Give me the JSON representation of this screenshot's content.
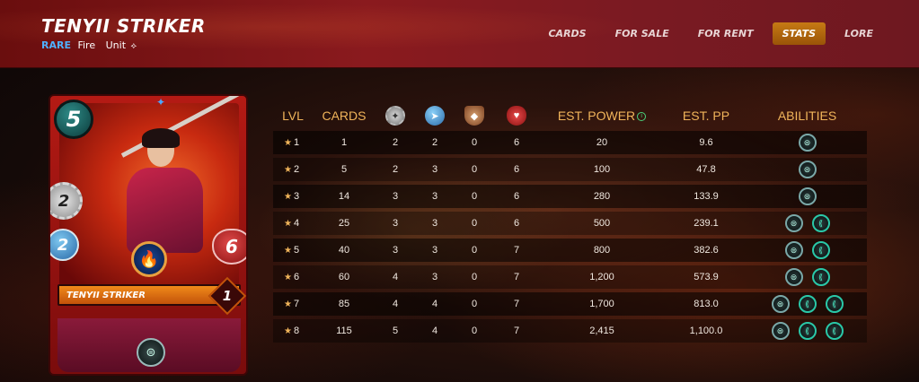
{
  "header": {
    "title": "TENYII STRIKER",
    "rarity": "RARE",
    "element": "Fire",
    "type": "Unit",
    "type_icon": "unit-icon"
  },
  "nav": {
    "tabs": [
      {
        "label": "CARDS",
        "active": false
      },
      {
        "label": "FOR SALE",
        "active": false
      },
      {
        "label": "FOR RENT",
        "active": false
      },
      {
        "label": "STATS",
        "active": true
      },
      {
        "label": "LORE",
        "active": false
      }
    ]
  },
  "card": {
    "mana": "5",
    "attack": "2",
    "speed": "2",
    "health": "6",
    "name": "TENYII STRIKER",
    "level": "1",
    "element_icon": "fire-element-icon",
    "ability_icon": "shield-ability-icon"
  },
  "table": {
    "headers": {
      "lvl": "LVL",
      "cards": "CARDS",
      "attack_icon": "melee-attack-icon",
      "speed_icon": "speed-icon",
      "armor_icon": "armor-icon",
      "health_icon": "health-icon",
      "est_power": "EST. POWER",
      "est_pp": "EST. PP",
      "abilities": "ABILITIES"
    },
    "rows": [
      {
        "lvl": "1",
        "cards": "1",
        "attack": "2",
        "speed": "2",
        "armor": "0",
        "health": "6",
        "power": "20",
        "pp": "9.6",
        "abilities": 1
      },
      {
        "lvl": "2",
        "cards": "5",
        "attack": "2",
        "speed": "3",
        "armor": "0",
        "health": "6",
        "power": "100",
        "pp": "47.8",
        "abilities": 1
      },
      {
        "lvl": "3",
        "cards": "14",
        "attack": "3",
        "speed": "3",
        "armor": "0",
        "health": "6",
        "power": "280",
        "pp": "133.9",
        "abilities": 1
      },
      {
        "lvl": "4",
        "cards": "25",
        "attack": "3",
        "speed": "3",
        "armor": "0",
        "health": "6",
        "power": "500",
        "pp": "239.1",
        "abilities": 2
      },
      {
        "lvl": "5",
        "cards": "40",
        "attack": "3",
        "speed": "3",
        "armor": "0",
        "health": "7",
        "power": "800",
        "pp": "382.6",
        "abilities": 2
      },
      {
        "lvl": "6",
        "cards": "60",
        "attack": "4",
        "speed": "3",
        "armor": "0",
        "health": "7",
        "power": "1,200",
        "pp": "573.9",
        "abilities": 2
      },
      {
        "lvl": "7",
        "cards": "85",
        "attack": "4",
        "speed": "4",
        "armor": "0",
        "health": "7",
        "power": "1,700",
        "pp": "813.0",
        "abilities": 3
      },
      {
        "lvl": "8",
        "cards": "115",
        "attack": "5",
        "speed": "4",
        "armor": "0",
        "health": "7",
        "power": "2,415",
        "pp": "1,100.0",
        "abilities": 3
      }
    ]
  },
  "colors": {
    "accent": "#f0b45a",
    "rarity": "#4fb0ff",
    "active_tab": "#c67a14"
  }
}
